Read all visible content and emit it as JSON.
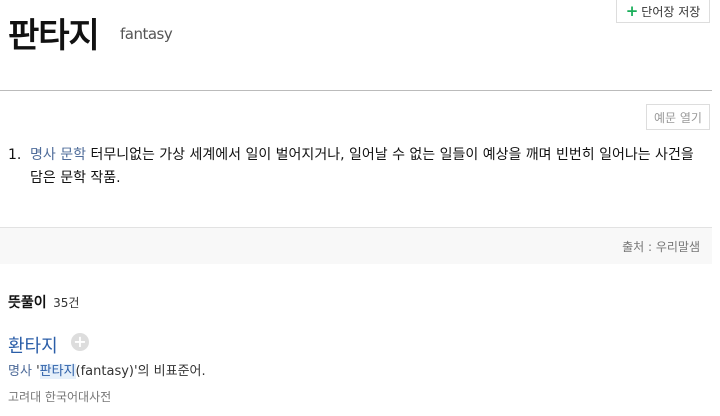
{
  "header": {
    "word": "판타지",
    "original": "fantasy",
    "save_plus": "+",
    "save_label": "단어장 저장"
  },
  "example_button": "예문 열기",
  "definition": {
    "number": "1.",
    "pos": "명사 문학",
    "text": "터무니없는 가상 세계에서 일이 벌어지거나, 일어날 수 없는 일들이 예상을 깨며 빈번히 일어나는 사건을 담은 문학 작품."
  },
  "source": "출처 : 우리말샘",
  "meaning_section": {
    "title": "뜻풀이",
    "count": "35건"
  },
  "entry": {
    "word": "환타지",
    "add_icon": "+",
    "pos": "명사",
    "def_prefix": "'",
    "def_highlight": "판타지",
    "def_suffix": "(fantasy)'의 비표준어.",
    "dictionary": "고려대 한국어대사전"
  }
}
